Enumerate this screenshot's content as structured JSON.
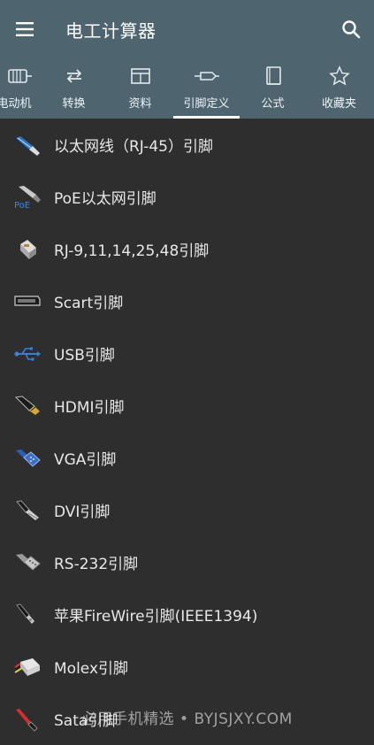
{
  "app": {
    "title": "电工计算器"
  },
  "tabs": [
    {
      "label": "电动机",
      "icon": "motor-icon"
    },
    {
      "label": "转换",
      "icon": "convert-icon"
    },
    {
      "label": "资料",
      "icon": "table-icon"
    },
    {
      "label": "引脚定义",
      "icon": "connector-icon"
    },
    {
      "label": "公式",
      "icon": "book-icon"
    },
    {
      "label": "收藏夹",
      "icon": "star-icon"
    }
  ],
  "active_tab": "引脚定义",
  "items": [
    {
      "label": "以太网线（RJ-45）引脚",
      "icon": "ethernet-cable-icon"
    },
    {
      "label": "PoE以太网引脚",
      "icon": "poe-icon"
    },
    {
      "label": "RJ-9,11,14,25,48引脚",
      "icon": "rj-connector-icon"
    },
    {
      "label": "Scart引脚",
      "icon": "scart-icon"
    },
    {
      "label": "USB引脚",
      "icon": "usb-icon"
    },
    {
      "label": "HDMI引脚",
      "icon": "hdmi-icon"
    },
    {
      "label": "VGA引脚",
      "icon": "vga-icon"
    },
    {
      "label": "DVI引脚",
      "icon": "dvi-icon"
    },
    {
      "label": "RS-232引脚",
      "icon": "rs232-icon"
    },
    {
      "label": "苹果FireWire引脚(IEEE1394)",
      "icon": "firewire-icon"
    },
    {
      "label": "Molex引脚",
      "icon": "molex-icon"
    },
    {
      "label": "Sata引脚",
      "icon": "sata-icon"
    }
  ],
  "watermark": "必用手机精选 • BYJSJXY.COM",
  "colors": {
    "appbar": "#4e6570",
    "background": "#2e2e2e",
    "text": "#e8e8e8"
  }
}
